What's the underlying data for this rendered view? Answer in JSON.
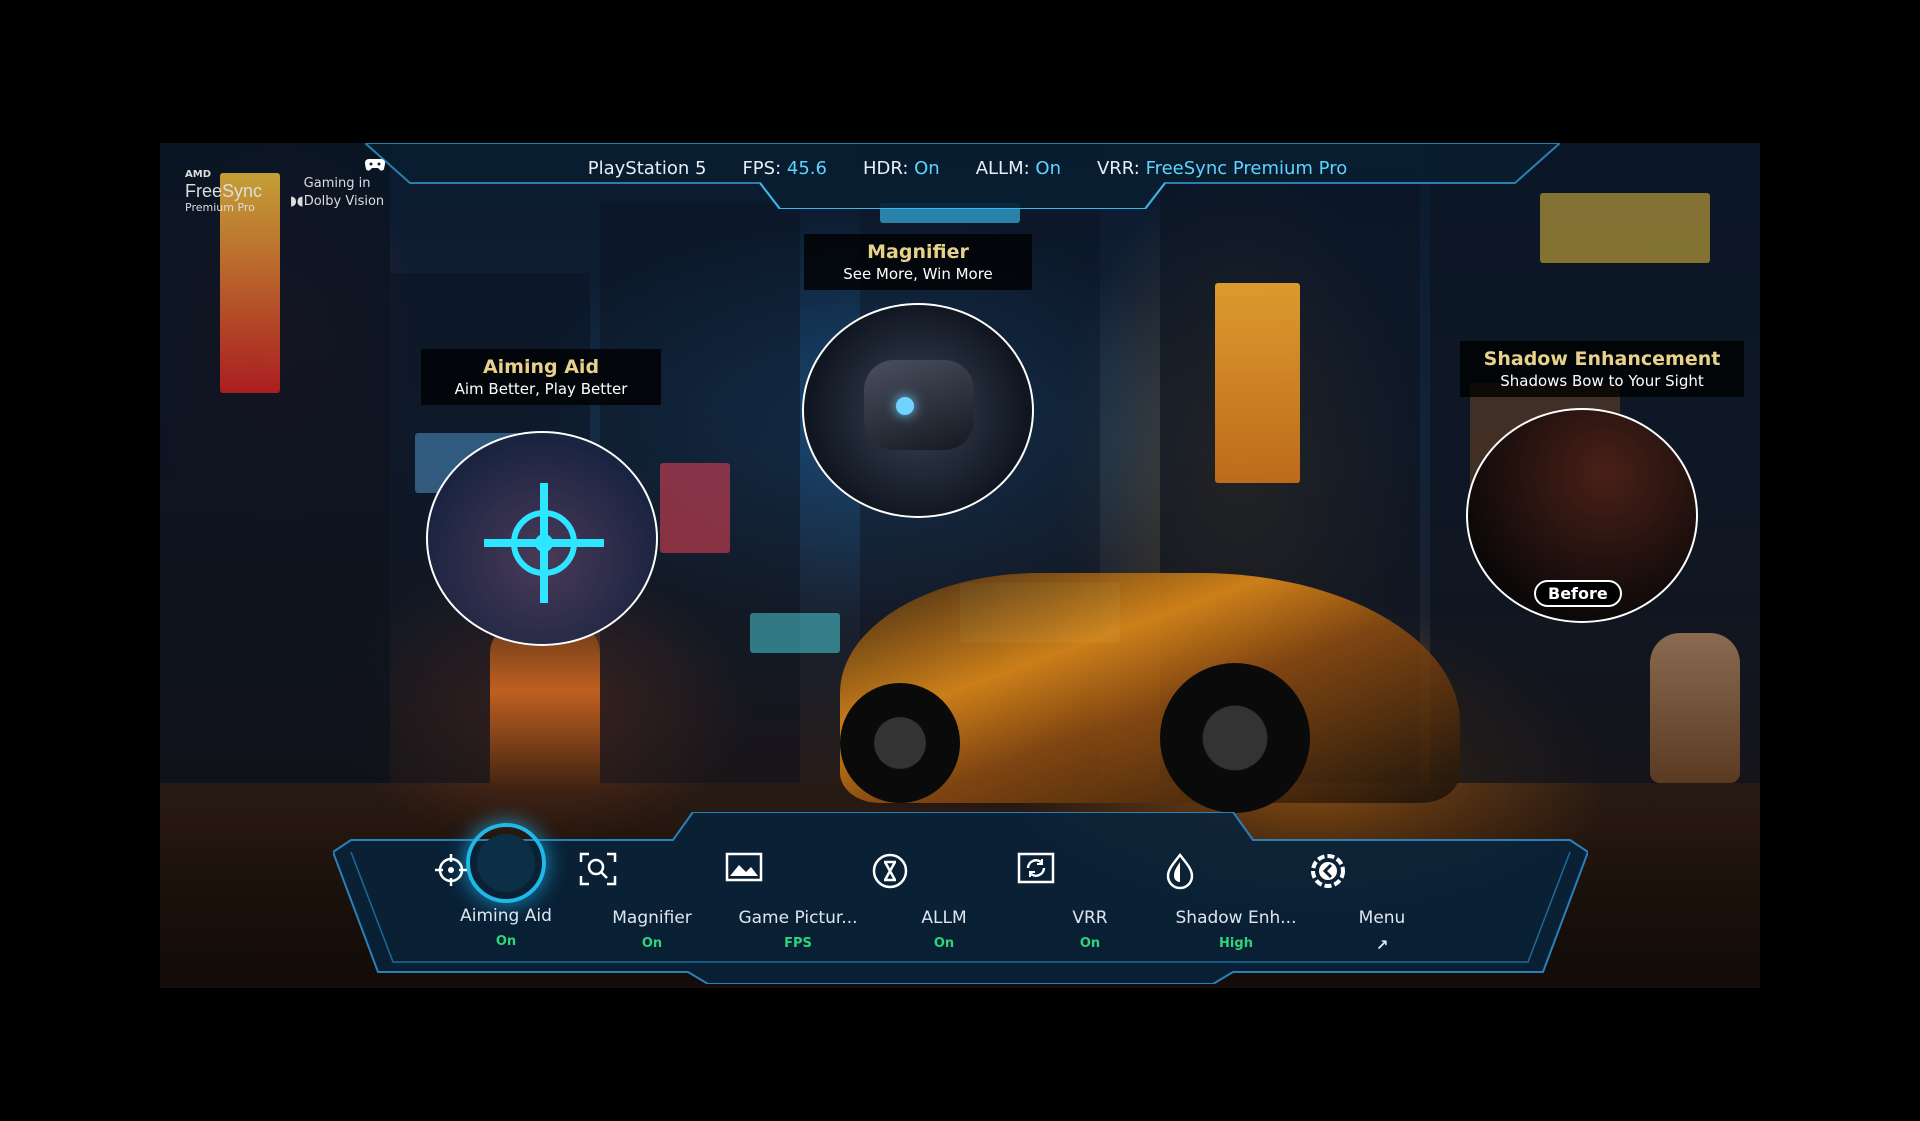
{
  "logos": {
    "amd_small": "AMD",
    "freesync": "FreeSync",
    "freesync_sub": "Premium Pro",
    "dolby_line1": "Gaming in",
    "dolby_line2": "Dolby Vision"
  },
  "status_bar": {
    "source": "PlayStation 5",
    "fps_label": "FPS:",
    "fps_value": "45.6",
    "hdr_label": "HDR:",
    "hdr_value": "On",
    "allm_label": "ALLM:",
    "allm_value": "On",
    "vrr_label": "VRR:",
    "vrr_value": "FreeSync Premium Pro",
    "icon": "gamepad-icon"
  },
  "callouts": {
    "aiming": {
      "title": "Aiming Aid",
      "subtitle": "Aim Better, Play Better"
    },
    "magnifier": {
      "title": "Magnifier",
      "subtitle": "See More, Win More"
    },
    "shadow": {
      "title": "Shadow Enhancement",
      "subtitle": "Shadows Bow to Your Sight",
      "tag": "Before"
    }
  },
  "menu": {
    "items": [
      {
        "label": "Aiming Aid",
        "value": "On",
        "icon": "crosshair-icon",
        "active": true
      },
      {
        "label": "Magnifier",
        "value": "On",
        "icon": "magnifier-icon"
      },
      {
        "label": "Game Pictur...",
        "value": "FPS",
        "icon": "picture-icon"
      },
      {
        "label": "ALLM",
        "value": "On",
        "icon": "allm-icon"
      },
      {
        "label": "VRR",
        "value": "On",
        "icon": "vrr-icon"
      },
      {
        "label": "Shadow Enh...",
        "value": "High",
        "icon": "shadow-icon"
      },
      {
        "label": "Menu",
        "value": "↗",
        "icon": "menu-icon"
      }
    ]
  },
  "colors": {
    "accent": "#1fb8e8",
    "value_green": "#2ed47a",
    "value_blue": "#5fd3ff",
    "title_gold": "#e8d28a"
  }
}
